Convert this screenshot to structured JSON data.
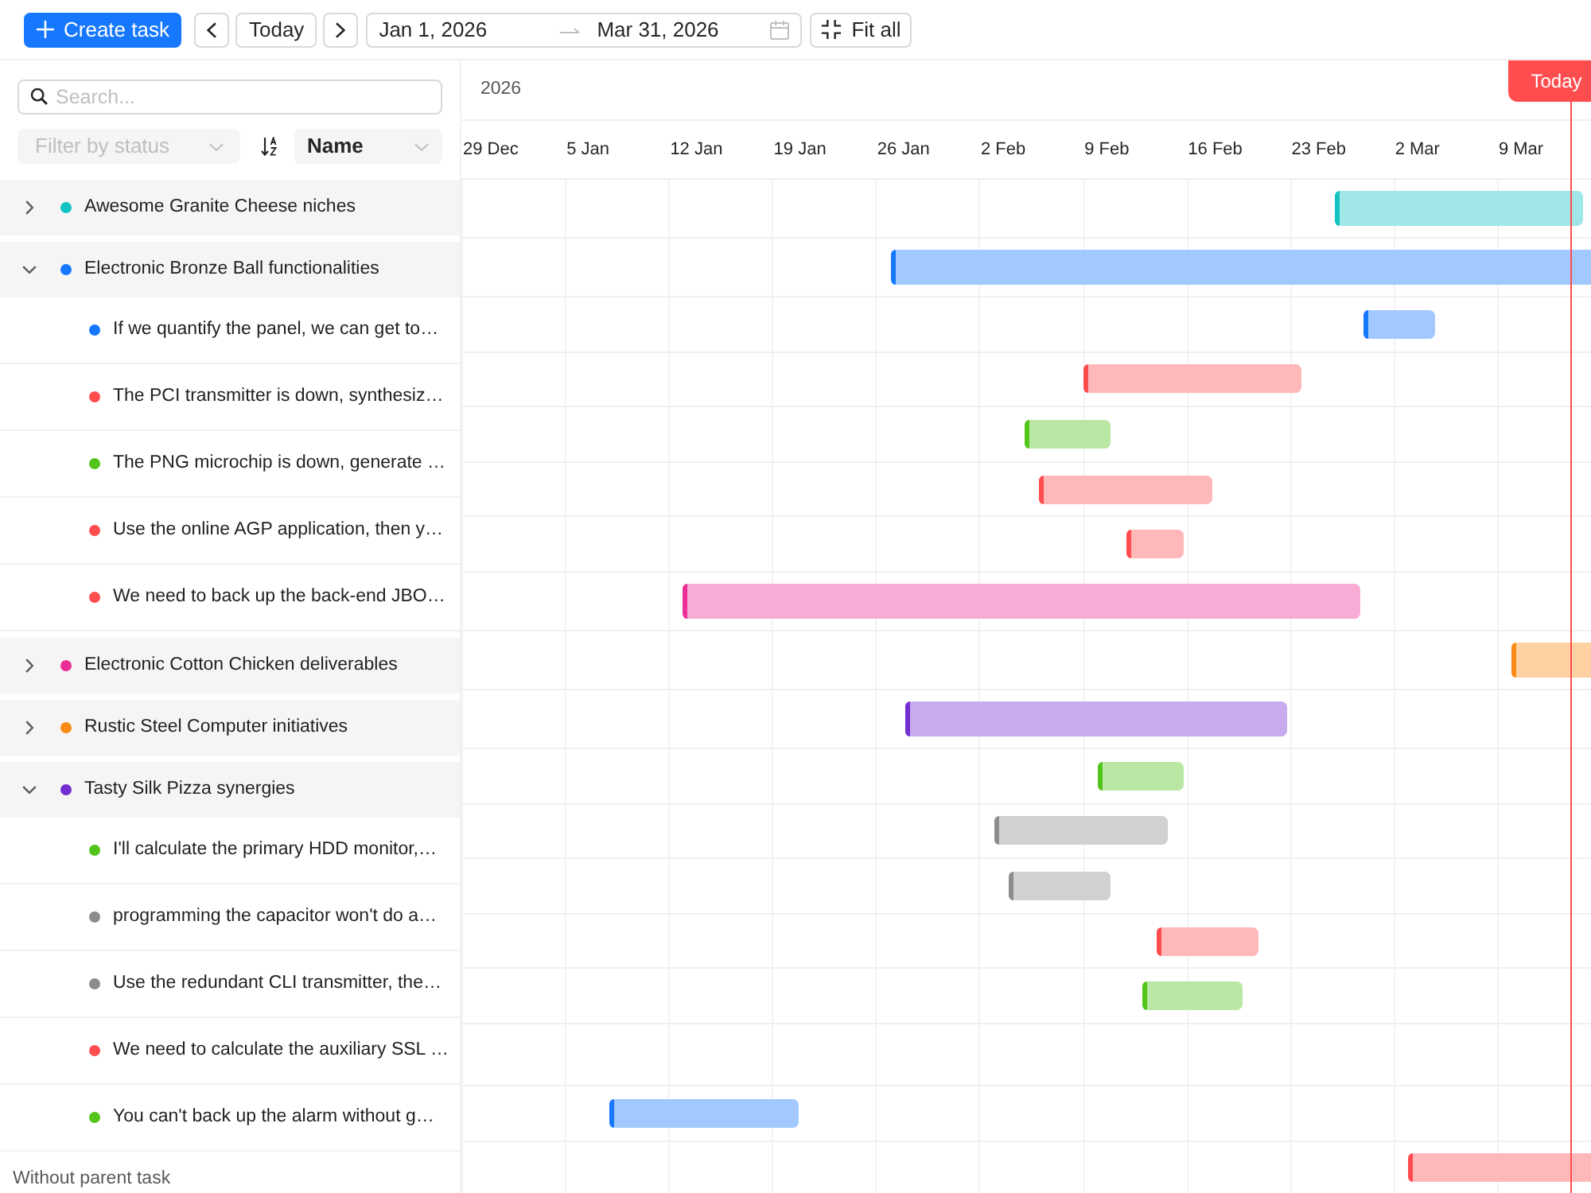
{
  "toolbar": {
    "create_button": "Create task",
    "today_button": "Today",
    "date_range": {
      "start": "Jan 1, 2026",
      "end": "Mar 31, 2026"
    },
    "fit_button": "Fit all"
  },
  "task_list": {
    "search": {
      "placeholder": "Search..."
    },
    "filter": {
      "placeholder": "Filter by status",
      "disabled": true
    },
    "sort": {
      "value": "Name"
    },
    "groups": [
      {
        "name": "Awesome Granite Cheese niches",
        "color": "#13c2c2",
        "expanded": false
      },
      {
        "name": "Electronic Bronze Ball functionalities",
        "color": "#1677ff",
        "expanded": true,
        "children": [
          {
            "name": "If we quantify the panel, we can get to…",
            "color": "#1677ff"
          },
          {
            "name": "The PCI transmitter is down, synthesiz…",
            "color": "#ff4d4f"
          },
          {
            "name": "The PNG microchip is down, generate …",
            "color": "#52c41a"
          },
          {
            "name": "Use the online AGP application, then y…",
            "color": "#ff4d4f"
          },
          {
            "name": "We need to back up the back-end JBO…",
            "color": "#ff4d4f"
          }
        ]
      },
      {
        "name": "Electronic Cotton Chicken deliverables",
        "color": "#eb2f96",
        "expanded": false
      },
      {
        "name": "Rustic Steel Computer initiatives",
        "color": "#fa8c16",
        "expanded": false
      },
      {
        "name": "Tasty Silk Pizza synergies",
        "color": "#722ed1",
        "expanded": true,
        "children": [
          {
            "name": "I'll calculate the primary HDD monitor,…",
            "color": "#52c41a"
          },
          {
            "name": "programming the capacitor won't do a…",
            "color": "#8c8c8c"
          },
          {
            "name": "Use the redundant CLI transmitter, the…",
            "color": "#8c8c8c"
          },
          {
            "name": "We need to calculate the auxiliary SSL …",
            "color": "#ff4d4f"
          },
          {
            "name": "You can't back up the alarm without g…",
            "color": "#52c41a"
          }
        ]
      }
    ],
    "section_label": "Without parent task"
  },
  "timeline": {
    "year": "2026",
    "weeks": [
      "29 Dec",
      "5 Jan",
      "12 Jan",
      "19 Jan",
      "26 Jan",
      "2 Feb",
      "9 Feb",
      "16 Feb",
      "23 Feb",
      "2 Mar",
      "9 Mar"
    ],
    "today": {
      "label": "Today",
      "level": 0.982
    },
    "rows": [
      {
        "kind": "group",
        "bar": {
          "start": {
            "level": 0.773
          },
          "end": {
            "level": 0.993
          },
          "color": "#13c2c2"
        }
      },
      {
        "kind": "group",
        "bar": {
          "start": {
            "level": 0.38
          },
          "color": "#1677ff"
        }
      },
      {
        "kind": "task",
        "bar": {
          "start": {
            "level": 0.799
          },
          "end": {
            "level": 0.862
          },
          "color": "#1677ff"
        }
      },
      {
        "kind": "task",
        "bar": {
          "start": {
            "level": 0.55
          },
          "end": {
            "level": 0.744
          },
          "color": "#ff4d4f"
        }
      },
      {
        "kind": "task",
        "bar": {
          "start": {
            "level": 0.498
          },
          "end": {
            "level": 0.574
          },
          "color": "#52c41a"
        }
      },
      {
        "kind": "task",
        "bar": {
          "start": {
            "level": 0.511
          },
          "end": {
            "level": 0.665
          },
          "color": "#ff4d4f"
        }
      },
      {
        "kind": "task",
        "bar": {
          "start": {
            "level": 0.589
          },
          "end": {
            "level": 0.639
          },
          "color": "#ff4d4f"
        }
      },
      {
        "kind": "group",
        "bar": {
          "start": {
            "level": 0.196
          },
          "end": {
            "level": 0.796
          },
          "color": "#eb2f96"
        }
      },
      {
        "kind": "group",
        "bar": {
          "start": {
            "level": 0.93
          },
          "color": "#fa8c16"
        }
      },
      {
        "kind": "group",
        "bar": {
          "start": {
            "level": 0.393
          },
          "end": {
            "level": 0.731
          },
          "color": "#722ed1"
        }
      },
      {
        "kind": "task",
        "bar": {
          "start": {
            "level": 0.563
          },
          "end": {
            "level": 0.639
          },
          "color": "#52c41a"
        }
      },
      {
        "kind": "task",
        "bar": {
          "start": {
            "level": 0.472
          },
          "end": {
            "level": 0.626
          },
          "color": "#8c8c8c"
        }
      },
      {
        "kind": "task",
        "bar": {
          "start": {
            "level": 0.485
          },
          "end": {
            "level": 0.574
          },
          "color": "#8c8c8c"
        }
      },
      {
        "kind": "task",
        "bar": {
          "start": {
            "level": 0.616
          },
          "end": {
            "level": 0.705
          },
          "color": "#ff4d4f"
        }
      },
      {
        "kind": "task",
        "bar": {
          "start": {
            "level": 0.603
          },
          "end": {
            "level": 0.691
          },
          "color": "#52c41a"
        }
      },
      {
        "kind": "section"
      },
      {
        "kind": "task",
        "bar": {
          "start": {
            "level": 0.131
          },
          "end": {
            "level": 0.298
          },
          "color": "#1677ff"
        }
      },
      {
        "kind": "task",
        "bar": {
          "start": {
            "level": 0.838
          },
          "color": "#ff4d4f"
        }
      }
    ]
  }
}
